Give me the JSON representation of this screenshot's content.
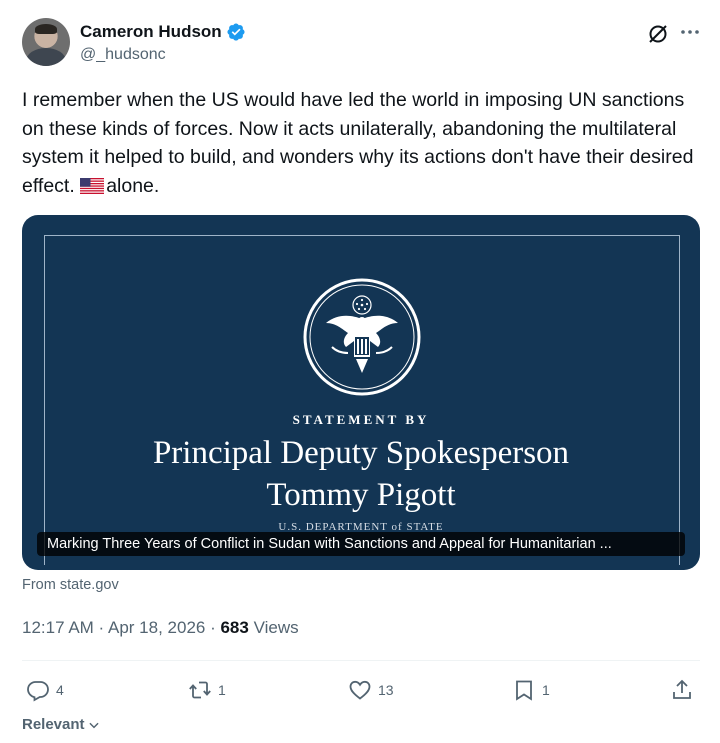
{
  "author": {
    "display_name": "Cameron Hudson",
    "handle": "@_hudsonc",
    "verified": true,
    "avatar_icon": "profile-photo"
  },
  "tweet": {
    "text": "I remember when the US would have led the world in imposing UN sanctions on these kinds of forces. Now it acts unilaterally, abandoning the multilateral system it helped to build, and wonders why its actions don't have their desired effect. ",
    "flag_icon": "us-flag-emoji",
    "text_suffix": "alone."
  },
  "card": {
    "statement_by": "STATEMENT BY",
    "title_line1": "Principal Deputy Spokesperson",
    "title_line2": "Tommy Pigott",
    "department": "U.S. DEPARTMENT of STATE",
    "caption": "Marking Three Years of Conflict in Sudan with Sanctions and Appeal for Humanitarian ...",
    "background_color": "#133554"
  },
  "source": "From state.gov",
  "meta": {
    "time_date": "12:17 AM · Apr 18, 2026 · ",
    "views_count": "683",
    "views_label": " Views"
  },
  "actions": {
    "replies": "4",
    "reposts": "1",
    "likes": "13",
    "bookmarks": "1"
  },
  "sort": {
    "label": "Relevant"
  },
  "colors": {
    "text": "#0f1419",
    "secondary": "#536471",
    "verified": "#1d9bf0",
    "divider": "#eff3f4"
  }
}
